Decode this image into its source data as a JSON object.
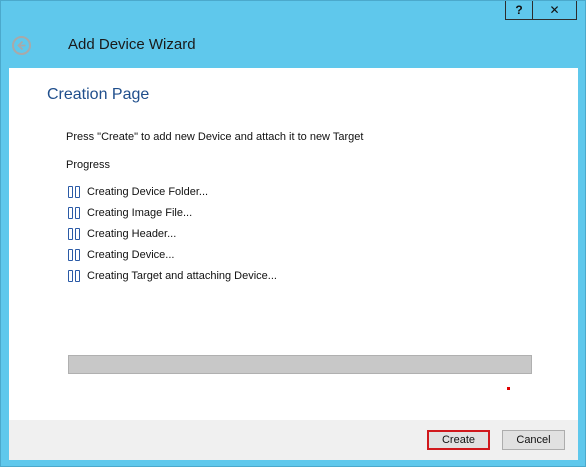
{
  "titlebar": {
    "help_label": "?",
    "close_label": "✕"
  },
  "wizard": {
    "title": "Add Device Wizard"
  },
  "page": {
    "title": "Creation Page",
    "instruction": "Press \"Create\" to add new Device and attach it to new Target",
    "progress_label": "Progress",
    "steps": [
      "Creating Device Folder...",
      "Creating Image File...",
      "Creating Header...",
      "Creating Device...",
      "Creating Target and attaching Device..."
    ],
    "progress_fraction": 0
  },
  "buttons": {
    "create": "Create",
    "cancel": "Cancel"
  },
  "colors": {
    "window_frame": "#5fc8ec",
    "title_blue": "#1f4e8c",
    "highlight_red": "#d0181c"
  }
}
